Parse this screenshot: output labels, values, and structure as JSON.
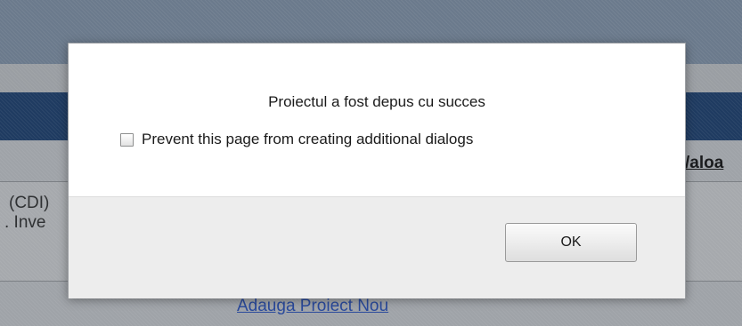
{
  "background_page": {
    "text_cdi": "(CDI)",
    "text_inve": ". Inve",
    "header_fragment": "/aloa",
    "add_project_link": "Adauga Proiect Nou"
  },
  "dialog": {
    "message": "Proiectul a fost depus cu succes",
    "prevent_label": "Prevent this page from creating additional dialogs",
    "prevent_checked": false,
    "ok_label": "OK"
  },
  "colors": {
    "navy_band": "#1f3b61",
    "dialog_bg": "#ffffff",
    "footer_bg": "#ededed",
    "link": "#2a4a9c"
  }
}
